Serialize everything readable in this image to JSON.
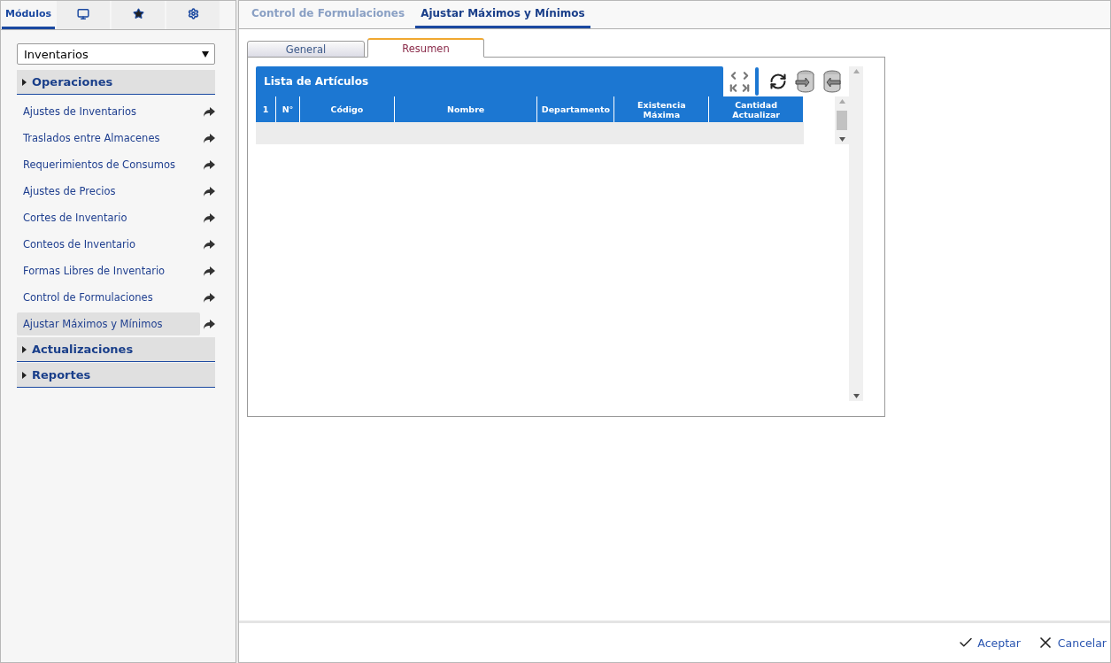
{
  "sidebar": {
    "tabs": [
      {
        "kind": "text",
        "label": "Módulos",
        "selected": true
      },
      {
        "kind": "monitor",
        "selected": false
      },
      {
        "kind": "star",
        "selected": false
      },
      {
        "kind": "gears",
        "selected": false
      }
    ],
    "module_select": {
      "value": "Inventarios"
    },
    "groups": [
      {
        "label": "Operaciones",
        "items": [
          {
            "label": "Ajustes de Inventarios",
            "selected": false
          },
          {
            "label": "Traslados entre Almacenes",
            "selected": false
          },
          {
            "label": "Requerimientos de Consumos",
            "selected": false
          },
          {
            "label": "Ajustes de Precios",
            "selected": false
          },
          {
            "label": "Cortes de Inventario",
            "selected": false
          },
          {
            "label": "Conteos de Inventario",
            "selected": false
          },
          {
            "label": "Formas Libres de Inventario",
            "selected": false
          },
          {
            "label": "Control de Formulaciones",
            "selected": false
          },
          {
            "label": "Ajustar Máximos y Mínimos",
            "selected": true
          }
        ]
      },
      {
        "label": "Actualizaciones"
      },
      {
        "label": "Reportes"
      }
    ]
  },
  "doc_tabs": [
    {
      "label": "Control de Formulaciones",
      "selected": false
    },
    {
      "label": "Ajustar Máximos y Mínimos",
      "selected": true
    }
  ],
  "form_tabs": [
    {
      "label": "General",
      "selected": false
    },
    {
      "label": "Resumen",
      "selected": true
    }
  ],
  "grid": {
    "title": "Lista de Artículos",
    "columns": [
      "1",
      "N°",
      "Código",
      "Nombre",
      "Departamento",
      "Existencia Máxima",
      "Cantidad Actualizar"
    ]
  },
  "footer": {
    "buttons": [
      {
        "kind": "accept",
        "label": "Aceptar"
      },
      {
        "kind": "cancel",
        "label": "Cancelar"
      }
    ]
  }
}
